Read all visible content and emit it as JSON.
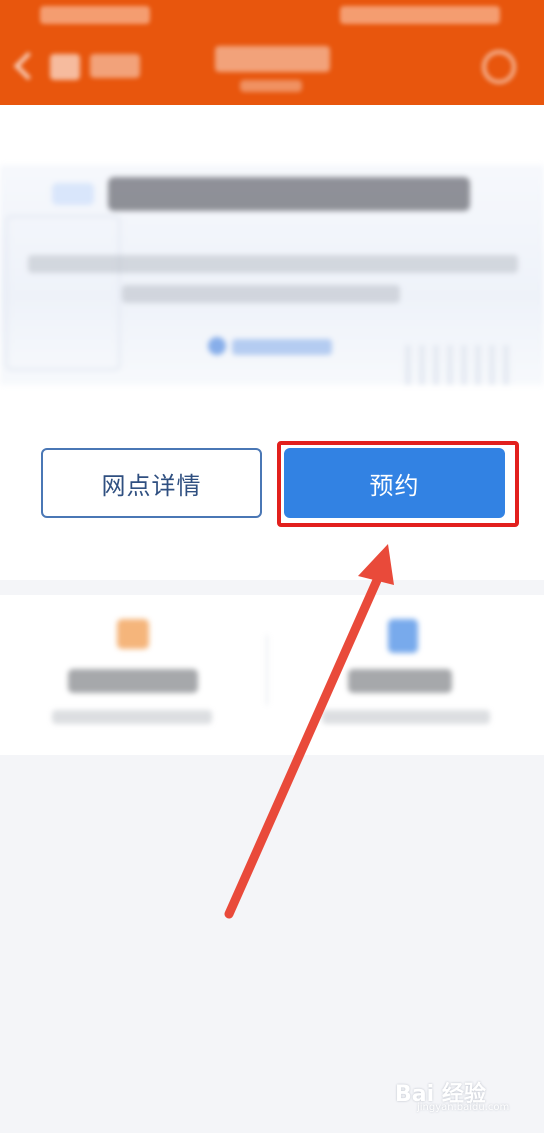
{
  "buttons": {
    "detail_label": "网点详情",
    "reserve_label": "预约"
  },
  "watermark": {
    "text": "Bai 经验",
    "sub": "jingyan.baidu.com"
  },
  "colors": {
    "header": "#e8560d",
    "primary": "#3282e3",
    "highlight": "#e2201d",
    "arrow": "#e94a3a"
  }
}
